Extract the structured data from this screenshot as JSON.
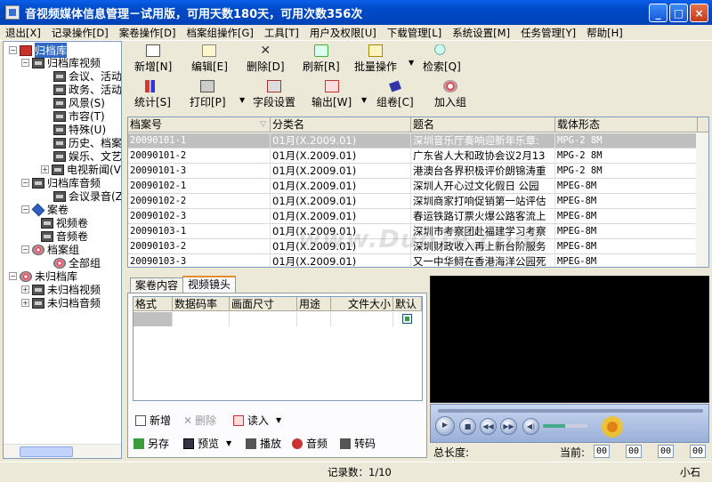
{
  "window": {
    "title": "音视频媒体信息管理－试用版，可用天数180天，可用次数356次",
    "min": "_",
    "max": "□",
    "close": "×"
  },
  "menu": [
    "退出[X]",
    "记录操作[D]",
    "案卷操作[D]",
    "档案组操作[G]",
    "工具[T]",
    "用户及权限[U]",
    "下载管理[L]",
    "系统设置[M]",
    "任务管理[Y]",
    "帮助[H]"
  ],
  "tree": {
    "root": "归档库",
    "video_lib": "归档库视频",
    "video_children": [
      "会议、活动",
      "政务、活动",
      "风景(S)",
      "市容(T)",
      "特殊(U)",
      "历史、档案",
      "娱乐、文艺",
      "电视新闻(V)"
    ],
    "audio_lib": "归档库音频",
    "audio_children": [
      "会议录音(Z)"
    ],
    "volumes": "案卷",
    "volume_children": [
      "视频卷",
      "音频卷"
    ],
    "groups": "档案组",
    "group_children": [
      "全部组"
    ],
    "unarchived": "未归档库",
    "unarchived_children": [
      "未归档视频",
      "未归档音频"
    ]
  },
  "toolbar": {
    "row1": [
      "新增[N]",
      "编辑[E]",
      "删除[D]",
      "刷新[R]",
      "批量操作",
      "检索[Q]"
    ],
    "row2": [
      "统计[S]",
      "打印[P]",
      "字段设置",
      "输出[W]",
      "组卷[C]",
      "加入组"
    ]
  },
  "grid": {
    "columns": [
      "档案号",
      "分类名",
      "题名",
      "载体形态"
    ],
    "rows": [
      [
        "20090101-1",
        "01月(X.2009.01)",
        "深圳音乐厅奏响迎新年乐章:",
        "MPG-2 8M"
      ],
      [
        "20090101-2",
        "01月(X.2009.01)",
        "广东省人大和政协会议2月13",
        "MPG-2 8M"
      ],
      [
        "20090101-3",
        "01月(X.2009.01)",
        "港澳台各界积极评价朗锦涛重",
        "MPG-2 8M"
      ],
      [
        "20090102-1",
        "01月(X.2009.01)",
        "深圳人开心过文化假日 公园",
        "MPEG-8M"
      ],
      [
        "20090102-2",
        "01月(X.2009.01)",
        "深圳商家打响促销第一站评估",
        "MPEG-8M"
      ],
      [
        "20090102-3",
        "01月(X.2009.01)",
        "春运铁路订票火爆公路客流上",
        "MPEG-8M"
      ],
      [
        "20090103-1",
        "01月(X.2009.01)",
        "深圳市考察团赴福建学习考察",
        "MPEG-8M"
      ],
      [
        "20090103-2",
        "01月(X.2009.01)",
        "深圳财政收入再上新台阶服务",
        "MPEG-8M"
      ],
      [
        "20090103-3",
        "01月(X.2009.01)",
        "又一中华鲟在香港海洋公园死",
        "MPEG-8M"
      ]
    ]
  },
  "tabs": [
    "案卷内容",
    "视频镜头"
  ],
  "subgrid": {
    "columns": [
      "格式",
      "数据码率",
      "画面尺寸",
      "用途",
      "文件大小",
      "默认"
    ]
  },
  "actions": {
    "row1": [
      "新增",
      "删除",
      "读入"
    ],
    "row2": [
      "另存",
      "预览",
      "播放",
      "音频",
      "转码"
    ]
  },
  "player": {
    "duration_label": "总长度:",
    "current_label": "当前:",
    "time_fields": [
      "00",
      "00",
      "00",
      "00"
    ]
  },
  "status": {
    "records": "记录数：1/10",
    "user": "小石"
  },
  "watermark": "www.DuoTe.com",
  "logo": {
    "name": "多特软件站",
    "sub": "国内最安全的软件站"
  }
}
